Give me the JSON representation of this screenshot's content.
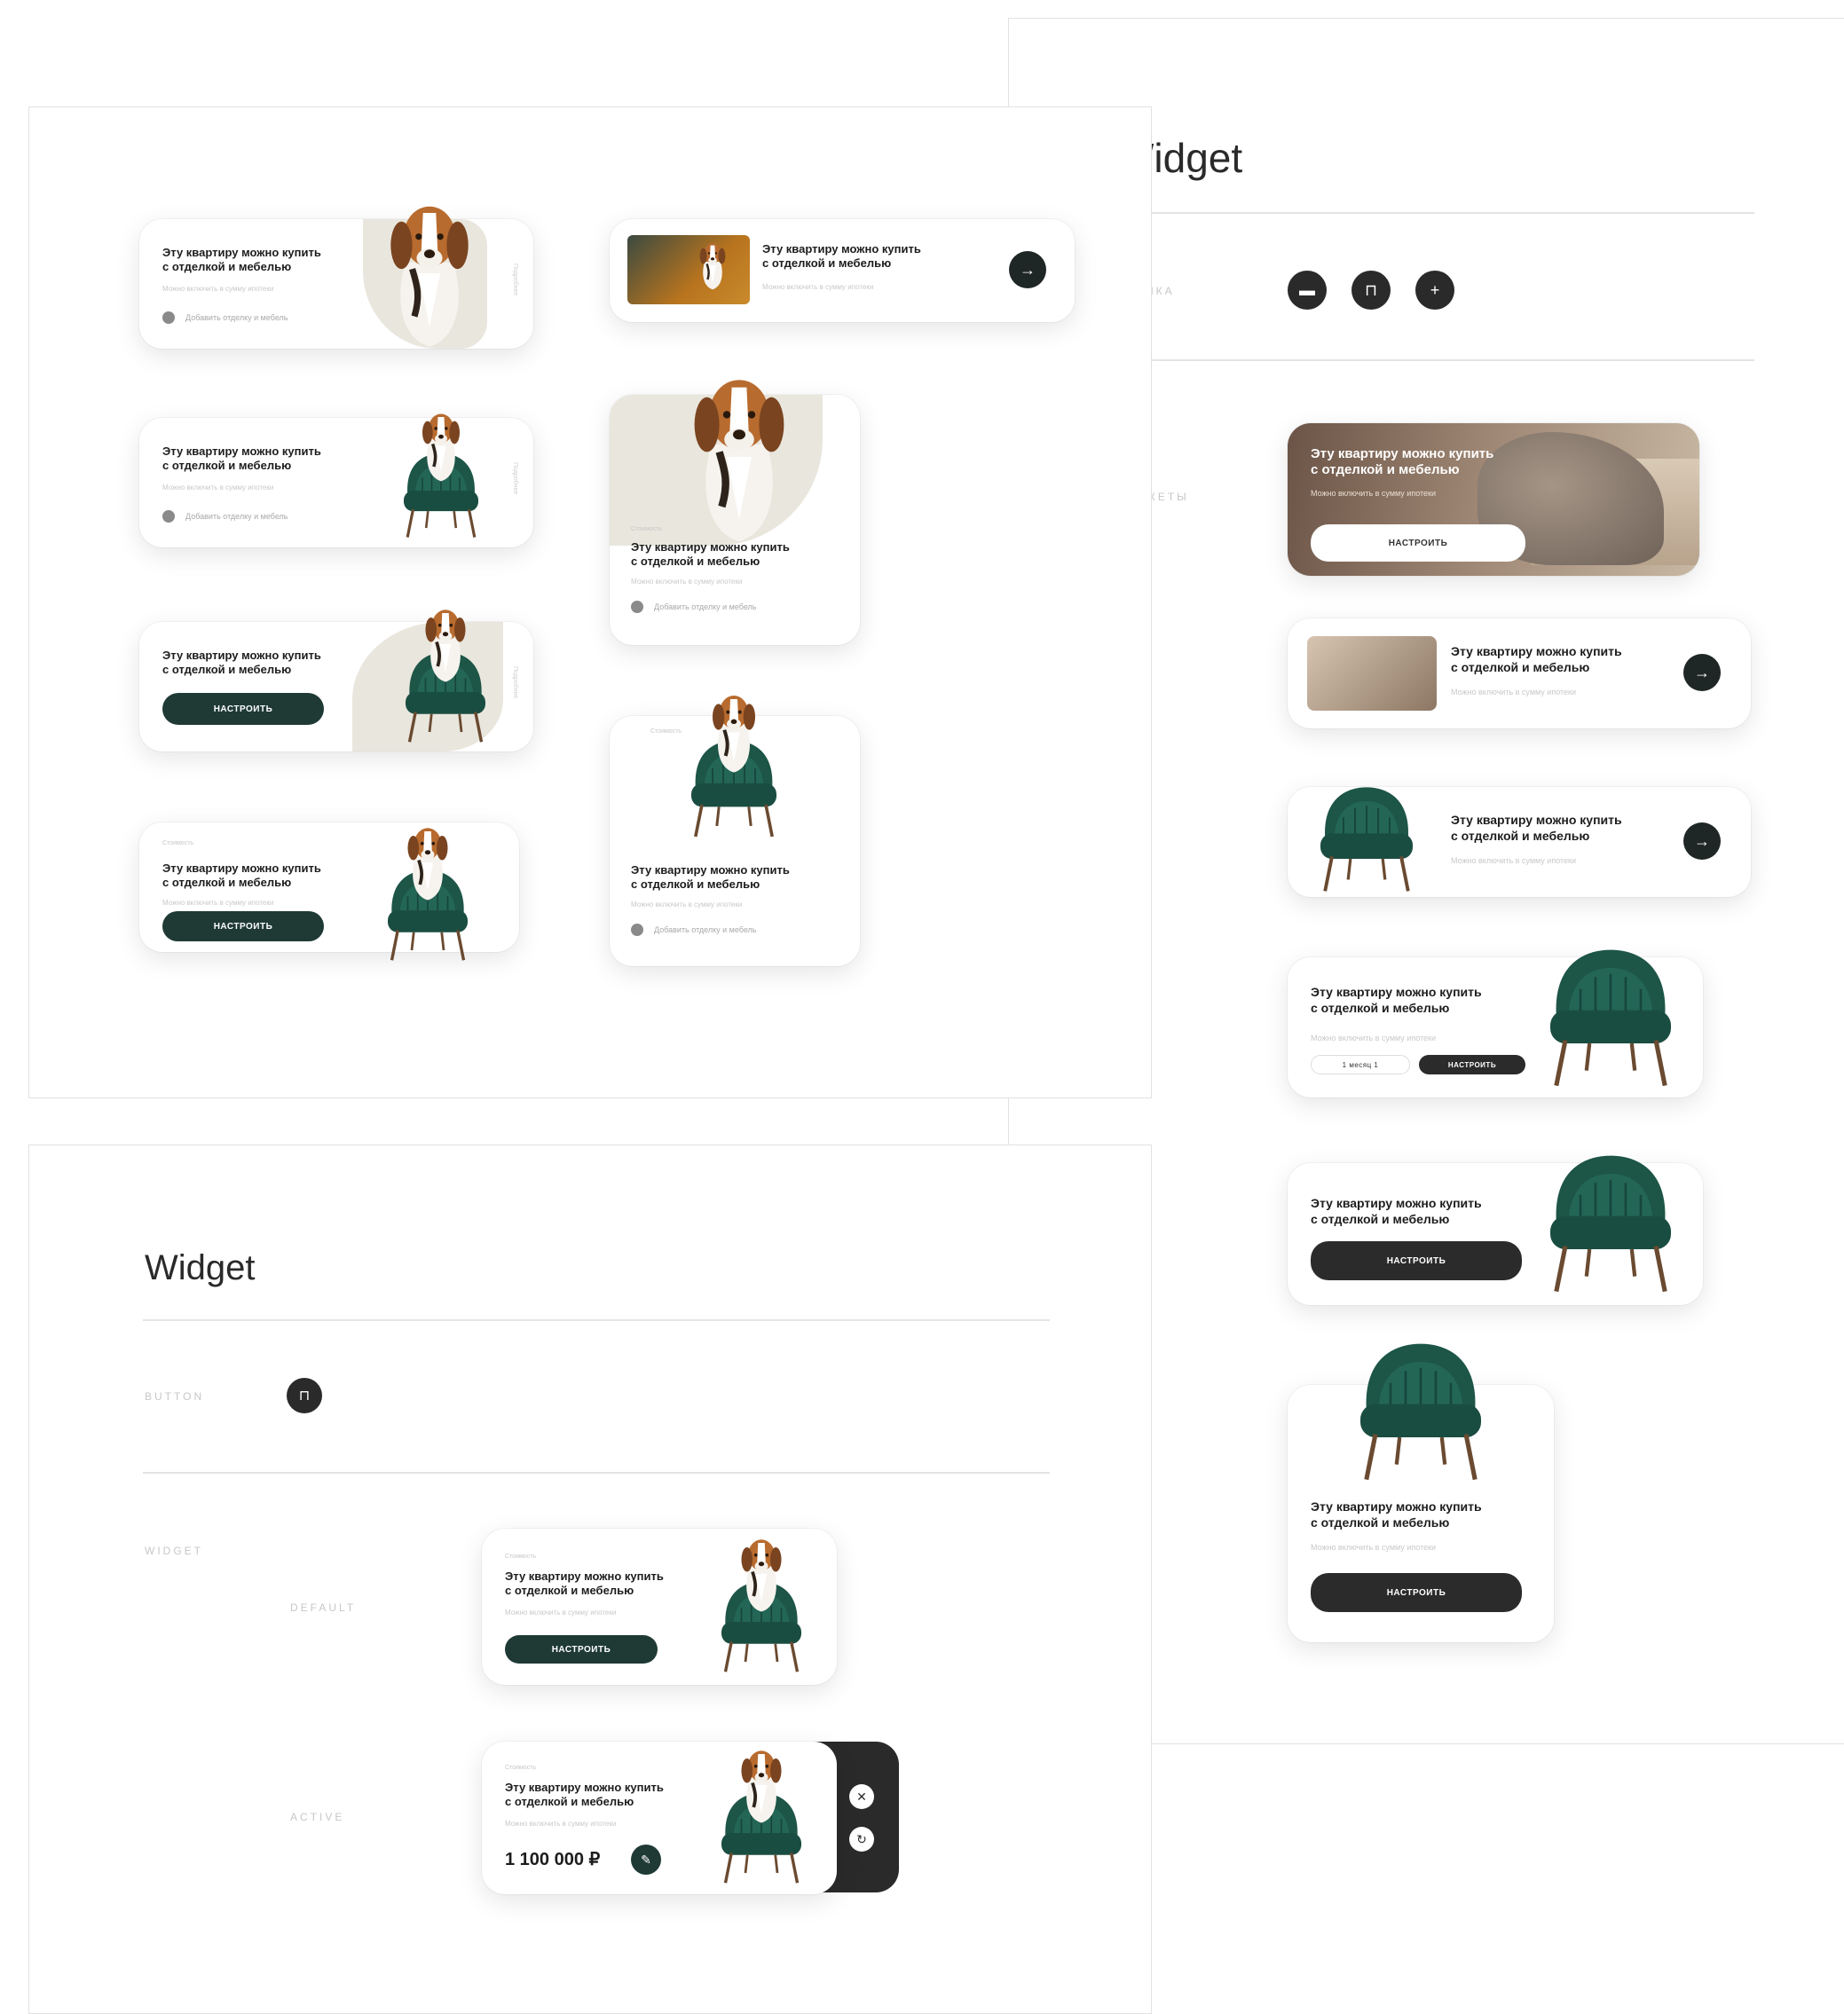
{
  "card_text": {
    "title": "Эту квартиру можно купить\nс отделкой и мебелью",
    "subtitle": "Можно включить в сумму ипотеки",
    "add_link": "Добавить отделку и мебель",
    "eyebrow": "Стоимость",
    "configure": "НАСТРОИТЬ",
    "side_label": "Подробнее",
    "chip_label": "1 месяц 1",
    "chip_button": "НАСТРОИТЬ"
  },
  "right_panel": {
    "title": "Widget",
    "row_button_label": "КНОПКА",
    "row_widget_label": "ВИДЖЕТЫ"
  },
  "bottom_panel": {
    "title": "Widget",
    "row_button_label": "BUTTON",
    "row_widget_label": "WIDGET",
    "state_default": "DEFAULT",
    "state_active": "ACTIVE",
    "price": "1 100 000 ₽"
  },
  "icons": {
    "sofa": "sofa-icon",
    "chair": "chair-icon",
    "plus": "plus-icon",
    "close": "close-icon",
    "refresh": "refresh-icon",
    "edit": "edit-pencil-icon",
    "arrow": "arrow-right-icon"
  },
  "colors": {
    "accent_green": "#1f3a35",
    "dark_button": "#2b2b2b",
    "chair_green": "#1e5a4e"
  }
}
